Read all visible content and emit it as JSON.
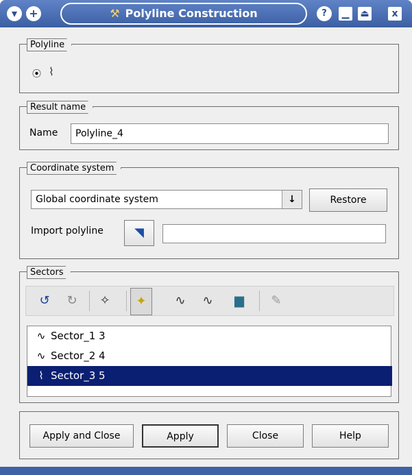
{
  "window": {
    "title": "Polyline Construction",
    "title_icon": "polyline-construction-icon"
  },
  "colors": {
    "titlebar": "#3f62a6",
    "panel": "#efefef",
    "selection": "#0b1f72"
  },
  "groups": {
    "polyline": {
      "label": "Polyline"
    },
    "result_name": {
      "label": "Result name",
      "name_label": "Name",
      "name_value": "Polyline_4"
    },
    "coordinate_system": {
      "label": "Coordinate system",
      "selected": "Global coordinate system",
      "restore_label": "Restore",
      "import_label": "Import polyline",
      "import_value": ""
    },
    "sectors": {
      "label": "Sectors",
      "tools": [
        "undo-icon",
        "redo-icon",
        "add-section-icon",
        "add-point-icon",
        "split-icon",
        "join-icon",
        "delete-icon",
        "edit-icon"
      ],
      "items": [
        {
          "label": "Sector_1 3",
          "selected": false
        },
        {
          "label": "Sector_2 4",
          "selected": false
        },
        {
          "label": "Sector_3 5",
          "selected": true
        }
      ]
    }
  },
  "footer": {
    "apply_close": "Apply and Close",
    "apply": "Apply",
    "close": "Close",
    "help": "Help"
  }
}
